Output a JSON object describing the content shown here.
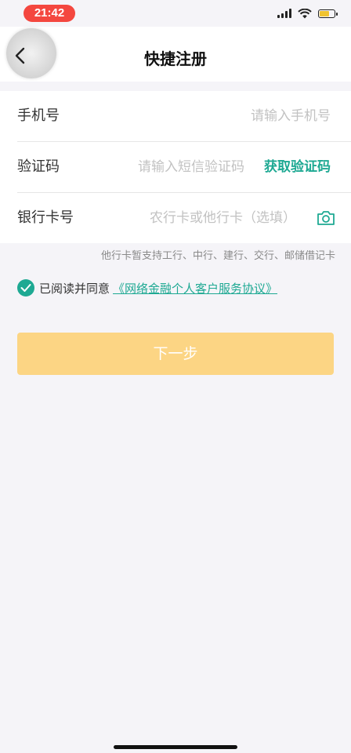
{
  "status": {
    "time": "21:42",
    "time_color": "#f4473f",
    "icons": [
      "cellular-signal-icon",
      "wifi-icon",
      "battery-charging-icon"
    ]
  },
  "nav": {
    "title": "快捷注册",
    "back_icon": "chevron-left-icon"
  },
  "form": {
    "phone": {
      "label": "手机号",
      "placeholder": "请输入手机号",
      "value": ""
    },
    "code": {
      "label": "验证码",
      "placeholder": "请输入短信验证码",
      "value": "",
      "action_label": "获取验证码"
    },
    "card": {
      "label": "银行卡号",
      "placeholder": "农行卡或他行卡（选填）",
      "value": "",
      "icon": "camera-icon"
    }
  },
  "hint": "他行卡暂支持工行、中行、建行、交行、邮储借记卡",
  "agreement": {
    "checked": true,
    "prefix": "已阅读并同意",
    "link": "《网络金融个人客户服务协议》"
  },
  "next_button_label": "下一步",
  "colors": {
    "accent": "#1ea993",
    "button_disabled": "#fcd584",
    "background": "#f5f4f8"
  }
}
